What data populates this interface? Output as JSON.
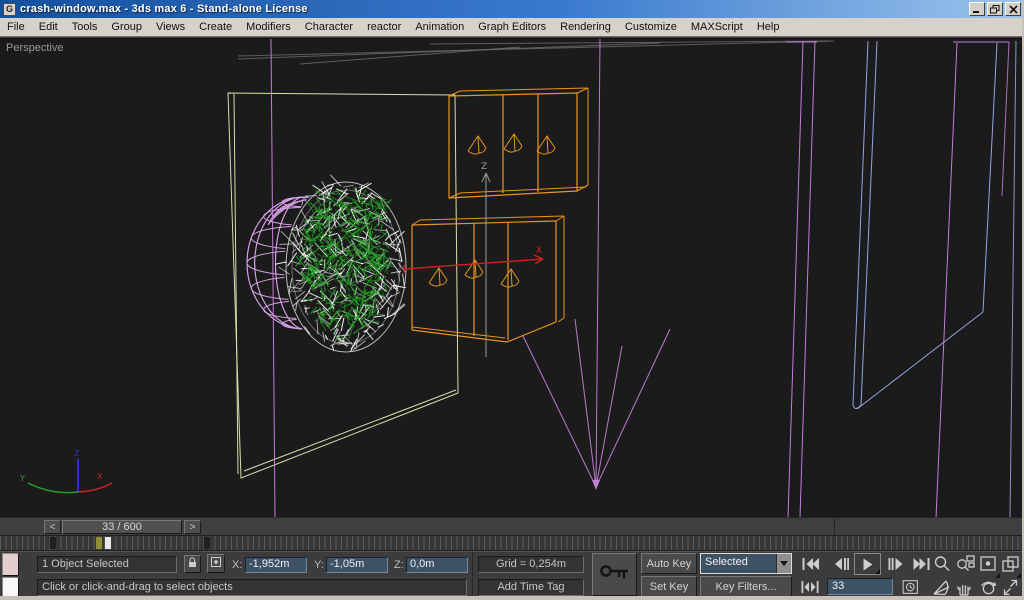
{
  "window": {
    "title": "crash-window.max - 3ds max 6 - Stand-alone License"
  },
  "menu": {
    "items": [
      "File",
      "Edit",
      "Tools",
      "Group",
      "Views",
      "Create",
      "Modifiers",
      "Character",
      "reactor",
      "Animation",
      "Graph Editors",
      "Rendering",
      "Customize",
      "MAXScript",
      "Help"
    ]
  },
  "viewport": {
    "label": "Perspective",
    "world_axis": {
      "x": "X",
      "y": "Y",
      "z": "Z"
    },
    "gizmo": {
      "x": "X",
      "z": "Z"
    }
  },
  "timeline": {
    "slider_label": "33 / 600",
    "prev": "<",
    "next": ">",
    "keys": [
      {
        "pos": 53,
        "kind": "key"
      },
      {
        "pos": 99,
        "kind": "key-olive"
      },
      {
        "pos": 108,
        "kind": "current"
      },
      {
        "pos": 207,
        "kind": "key"
      }
    ]
  },
  "status": {
    "selection": "1 Object Selected",
    "prompt": "Click or click-and-drag to select objects",
    "grid": "Grid = 0,254m",
    "add_time_tag": "Add Time Tag",
    "x_label": "X:",
    "x_value": "-1,952m",
    "y_label": "Y:",
    "y_value": "-1,05m",
    "z_label": "Z:",
    "z_value": "0,0m"
  },
  "animation": {
    "auto_key": "Auto Key",
    "set_key": "Set Key",
    "selection_set": "Selected",
    "key_filters": "Key Filters...",
    "frame": "33"
  },
  "colors": {
    "viewport_bg": "#1b1b1b",
    "magenta": "#c47fd6",
    "violet": "#d9a0e8",
    "orange": "#e8951e",
    "yellow": "#ddddab",
    "blue": "#96a2de",
    "green": "#23a523",
    "white": "#ffffff",
    "red": "#cf2020",
    "gray_line": "#6e6e6e",
    "axis_x": "#cc2626",
    "axis_y": "#26a426",
    "axis_z": "#2d2dd8",
    "gizmo_gray": "#9a9a9a"
  }
}
